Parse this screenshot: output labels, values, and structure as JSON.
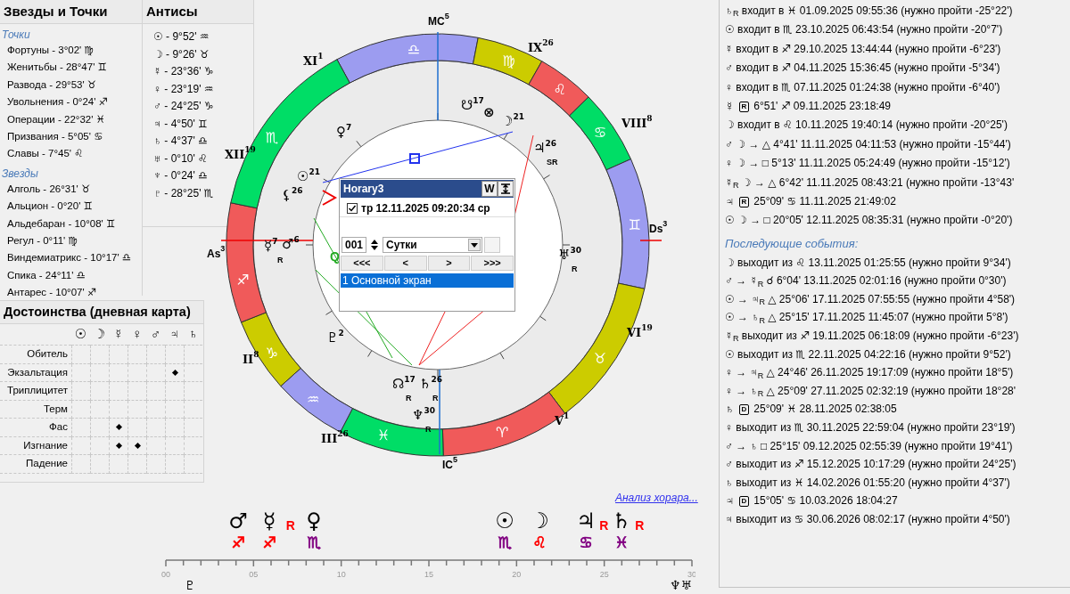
{
  "stars": {
    "title": "Звезды и Точки",
    "groups": [
      {
        "title": "Точки",
        "items": [
          "Фортуны - 3°02' ♍",
          "Женитьбы - 28°47' ♊",
          "Развода - 29°53' ♉",
          "Увольнения - 0°24' ♐",
          "Операции - 22°32' ♓",
          "Призвания - 5°05' ♋",
          "Славы - 7°45' ♌"
        ]
      },
      {
        "title": "Звезды",
        "items": [
          "Алголь - 26°31' ♉",
          "Альцион - 0°20' ♊",
          "Альдебаран - 10°08' ♊",
          "Регул - 0°11' ♍",
          "Виндемиатрикс - 10°17' ♎",
          "Спика - 24°11' ♎",
          "Антарес - 10°07' ♐"
        ]
      }
    ]
  },
  "antiscia": {
    "title": "Антисы",
    "items": [
      "☉ - 9°52' ♒",
      "☽ - 9°26' ♉",
      "☿ - 23°36' ♑",
      "♀ - 23°19' ♒",
      "♂ - 24°25' ♑",
      "♃ - 4°50' ♊",
      "♄ - 4°37' ♎",
      "♅ - 0°10' ♌",
      "♆ - 0°24' ♎",
      "♇ - 28°25' ♏"
    ]
  },
  "dignities": {
    "title": "Достоинства (дневная карта)",
    "columns": [
      "☉",
      "☽",
      "☿",
      "♀",
      "♂",
      "♃",
      "♄"
    ],
    "rows": [
      {
        "label": "Обитель",
        "marks": [
          false,
          false,
          false,
          false,
          false,
          false,
          false
        ]
      },
      {
        "label": "Экзальтация",
        "marks": [
          false,
          false,
          false,
          false,
          false,
          true,
          false
        ]
      },
      {
        "label": "Триплицитет",
        "marks": [
          false,
          false,
          false,
          false,
          false,
          false,
          false
        ]
      },
      {
        "label": "Терм",
        "marks": [
          false,
          false,
          false,
          false,
          false,
          false,
          false
        ]
      },
      {
        "label": "Фас",
        "marks": [
          false,
          false,
          true,
          false,
          false,
          false,
          false
        ]
      },
      {
        "label": "Изгнание",
        "marks": [
          false,
          false,
          true,
          true,
          false,
          false,
          false
        ]
      },
      {
        "label": "Падение",
        "marks": [
          false,
          false,
          false,
          false,
          false,
          false,
          false
        ]
      }
    ]
  },
  "wheel": {
    "angles": [
      {
        "label": "MC",
        "degree": "5"
      },
      {
        "label": "IC",
        "degree": "5"
      },
      {
        "label": "As",
        "degree": "3"
      },
      {
        "label": "Ds",
        "degree": "3"
      }
    ],
    "signs": [
      {
        "glyph": "♎",
        "color": "#9c9cf0"
      },
      {
        "glyph": "♍",
        "color": "#cccc00"
      },
      {
        "glyph": "♌",
        "color": "#f05a5a"
      },
      {
        "glyph": "♋",
        "color": "#00dd66"
      },
      {
        "glyph": "♊",
        "color": "#9c9cf0"
      },
      {
        "glyph": "♉",
        "color": "#cccc00"
      },
      {
        "glyph": "♈",
        "color": "#f05a5a"
      },
      {
        "glyph": "♓",
        "color": "#00dd66"
      },
      {
        "glyph": "♒",
        "color": "#9c9cf0"
      },
      {
        "glyph": "♑",
        "color": "#cccc00"
      },
      {
        "glyph": "♐",
        "color": "#f05a5a"
      },
      {
        "glyph": "♏",
        "color": "#00dd66"
      }
    ],
    "houses": [
      {
        "numeral": "XI",
        "degree": "1"
      },
      {
        "numeral": "IX",
        "degree": "26"
      },
      {
        "numeral": "VIII",
        "degree": "8"
      },
      {
        "numeral": "XII",
        "degree": "19"
      },
      {
        "numeral": "II",
        "degree": "8"
      },
      {
        "numeral": "III",
        "degree": "26"
      },
      {
        "numeral": "V",
        "degree": "1"
      },
      {
        "numeral": "VI",
        "degree": "19"
      }
    ],
    "planets": [
      {
        "glyph": "☋",
        "degree": "17"
      },
      {
        "glyph": "⊗"
      },
      {
        "glyph": "☽",
        "degree": "21"
      },
      {
        "glyph": "♃",
        "degree": "26",
        "motion": "SR"
      },
      {
        "glyph": "♀",
        "degree": "7"
      },
      {
        "glyph": "☉",
        "degree": "21"
      },
      {
        "glyph": "⚸",
        "degree": "26"
      },
      {
        "glyph": "☿",
        "degree": "7",
        "motion": "R"
      },
      {
        "glyph": "♂",
        "degree": "6"
      },
      {
        "glyph": "♇",
        "degree": "2"
      },
      {
        "glyph": "☊",
        "degree": "17",
        "motion": "R"
      },
      {
        "glyph": "♄",
        "degree": "26",
        "motion": "R"
      },
      {
        "glyph": "♆",
        "degree": "30",
        "motion": "R"
      },
      {
        "glyph": "♅",
        "degree": "30",
        "motion": "R"
      }
    ],
    "aspect_label": "Q"
  },
  "popup": {
    "title": "Horary3",
    "title_button": "W",
    "entries": [
      {
        "text": "тр 12.11.2025 09:20:34 ср",
        "checked": true
      }
    ],
    "step": "001",
    "period": "Сутки",
    "nav": [
      "<<<",
      "<",
      ">",
      ">>>"
    ],
    "screens": [
      {
        "text": "1 Основной экран",
        "selected": true
      }
    ]
  },
  "analysis_link": "Анализ хорара...",
  "strip": {
    "planets": [
      {
        "glyph": "♂",
        "sign": "♐",
        "color": "#ff0000"
      },
      {
        "glyph": "☿",
        "motion": "R",
        "sign": "♐",
        "color": "#ff0000"
      },
      {
        "glyph": "♀",
        "sign": "♏",
        "color": "#800080"
      },
      {
        "glyph": "☉",
        "sign": "♏",
        "color": "#800080"
      },
      {
        "glyph": "☽",
        "sign": "♌",
        "color": "#ff0000"
      },
      {
        "glyph": "♃",
        "motion": "R",
        "sign": "♋",
        "color": "#800080"
      },
      {
        "glyph": "♄",
        "motion": "R",
        "sign": "♓",
        "color": "#800080"
      }
    ],
    "ticks": [
      "00",
      "05",
      "10",
      "15",
      "20",
      "25",
      "30"
    ],
    "below": [
      "♇",
      "♆♅"
    ]
  },
  "events": [
    {
      "kind": "event",
      "text": "♄$_{R}$ входит в ♓ 01.09.2025 09:55:36 (нужно пройти -25°22')"
    },
    {
      "kind": "event",
      "text": "☉ входит в ♏ 23.10.2025 06:43:54 (нужно пройти -20°7')"
    },
    {
      "kind": "event",
      "text": "☿ входит в ♐ 29.10.2025 13:44:44 (нужно пройти -6°23')"
    },
    {
      "kind": "event",
      "text": "♂ входит в ♐ 04.11.2025 15:36:45 (нужно пройти -5°34')"
    },
    {
      "kind": "event",
      "text": "♀ входит в ♏ 07.11.2025 01:24:38 (нужно пройти -6°40')"
    },
    {
      "kind": "station",
      "planet": "☿",
      "station": "R",
      "text": "6°51' ♐ 09.11.2025 23:18:49"
    },
    {
      "kind": "event",
      "text": "☽ входит в ♌ 10.11.2025 19:40:14 (нужно пройти -20°25')"
    },
    {
      "kind": "event",
      "text": "♂ ☽ → △ 4°41' 11.11.2025 04:11:53 (нужно пройти -15°44')"
    },
    {
      "kind": "event",
      "text": "♀ ☽ → □ 5°13' 11.11.2025 05:24:49 (нужно пройти -15°12')"
    },
    {
      "kind": "event",
      "text": "☿$_{R}$ ☽ → △ 6°42' 11.11.2025 08:43:21 (нужно пройти -13°43'"
    },
    {
      "kind": "station",
      "planet": "♃",
      "station": "R",
      "text": "25°09' ♋ 11.11.2025 21:49:02"
    },
    {
      "kind": "event",
      "text": "☉ ☽ → □ 20°05' 12.11.2025 08:35:31 (нужно пройти -0°20')"
    }
  ],
  "following_title": "Последующие события:",
  "following": [
    {
      "kind": "event",
      "text": "☽ выходит из ♌ 13.11.2025 01:25:55 (нужно пройти 9°34')"
    },
    {
      "kind": "event",
      "text": "♂ → ☿$_{R}$ ☌ 6°04' 13.11.2025 02:01:16 (нужно пройти 0°30')"
    },
    {
      "kind": "event",
      "text": "☉ → ♃$_{R}$ △ 25°06' 17.11.2025 07:55:55 (нужно пройти 4°58')"
    },
    {
      "kind": "event",
      "text": "☉ → ♄$_{R}$ △ 25°15' 17.11.2025 11:45:07 (нужно пройти 5°8')"
    },
    {
      "kind": "event",
      "text": "☿$_{R}$ выходит из ♐ 19.11.2025 06:18:09 (нужно пройти -6°23')"
    },
    {
      "kind": "event",
      "text": "☉ выходит из ♏ 22.11.2025 04:22:16 (нужно пройти 9°52')"
    },
    {
      "kind": "event",
      "text": "♀ → ♃$_{R}$ △ 24°46' 26.11.2025 19:17:09 (нужно пройти 18°5')"
    },
    {
      "kind": "event",
      "text": "♀ → ♄$_{R}$ △ 25°09' 27.11.2025 02:32:19 (нужно пройти 18°28'"
    },
    {
      "kind": "station",
      "planet": "♄",
      "station": "D",
      "text": "25°09' ♓ 28.11.2025 02:38:05"
    },
    {
      "kind": "event",
      "text": "♀ выходит из ♏ 30.11.2025 22:59:04 (нужно пройти 23°19')"
    },
    {
      "kind": "event",
      "text": "♂ → ♄ □ 25°15' 09.12.2025 02:55:39 (нужно пройти 19°41')"
    },
    {
      "kind": "event",
      "text": "♂ выходит из ♐ 15.12.2025 10:17:29 (нужно пройти 24°25')"
    },
    {
      "kind": "event",
      "text": "♄ выходит из ♓ 14.02.2026 01:55:20 (нужно пройти 4°37')"
    },
    {
      "kind": "station",
      "planet": "♃",
      "station": "D",
      "text": "15°05' ♋ 10.03.2026 18:04:27"
    },
    {
      "kind": "event",
      "text": "♃ выходит из ♋ 30.06.2026 08:02:17 (нужно пройти 4°50')"
    }
  ]
}
